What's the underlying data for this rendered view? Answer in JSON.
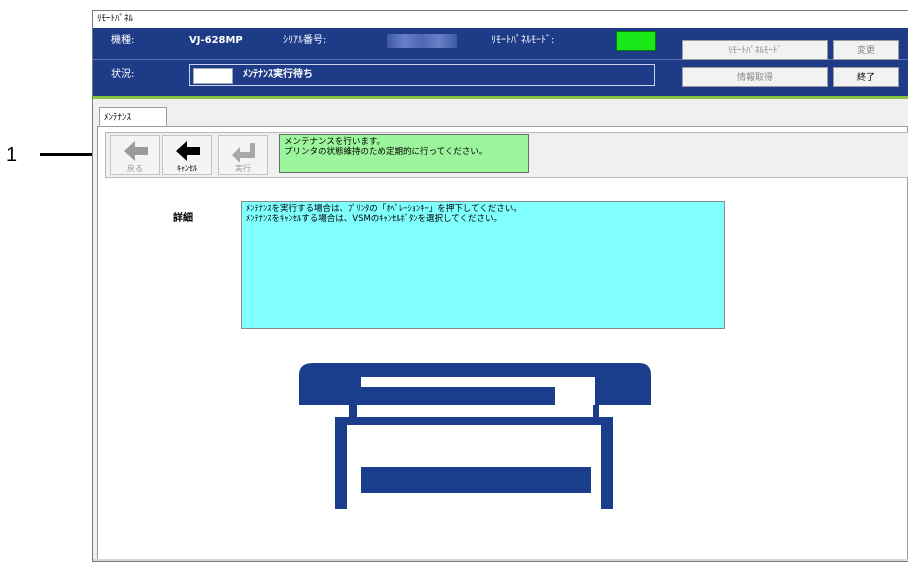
{
  "callout": {
    "number": "1"
  },
  "window": {
    "title": "ﾘﾓｰﾄﾊﾟﾈﾙ"
  },
  "header": {
    "model_label": "機種:",
    "model_value": "VJ-628MP",
    "serial_label": "ｼﾘｱﾙ番号:",
    "remote_mode_label": "ﾘﾓｰﾄﾊﾟﾈﾙﾓｰﾄﾞ:",
    "status_label": "状況:",
    "status_value": "ﾒﾝﾃﾅﾝｽ実行待ち",
    "indicator_color": "#18e818",
    "header_color": "#1e3b87",
    "buttons": {
      "remote_mode": "ﾘﾓｰﾄﾊﾟﾈﾙﾓｰﾄﾞ",
      "change": "変更",
      "get_info": "情報取得",
      "exit": "終了"
    }
  },
  "tab": {
    "label": "ﾒﾝﾃﾅﾝｽ"
  },
  "toolbar": {
    "back_label": "戻る",
    "cancel_label": "ｷｬﾝｾﾙ",
    "execute_label": "実行"
  },
  "message": {
    "line1": "メンテナンスを行います。",
    "line2": "プリンタの状態維持のため定期的に行ってください。",
    "color": "#9cf59c"
  },
  "detail": {
    "label": "詳細",
    "line1": "ﾒﾝﾃﾅﾝｽを実行する場合は、ﾌﾟﾘﾝﾀの「ｵﾍﾟﾚｰｼｮﾝｷｰ」を押下してください。",
    "line2": "ﾒﾝﾃﾅﾝｽをｷｬﾝｾﾙする場合は、VSMのｷｬﾝｾﾙﾎﾞﾀﾝを選択してください。",
    "color": "#80ffff"
  },
  "printer_color": "#1a3d8c"
}
